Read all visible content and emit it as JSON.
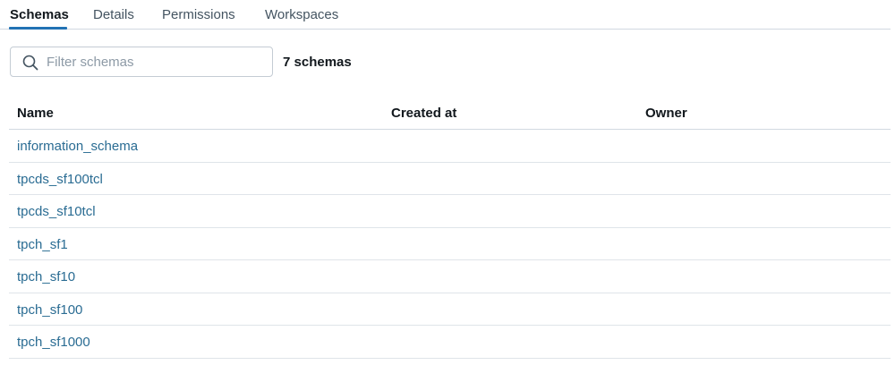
{
  "tabs": [
    {
      "label": "Schemas",
      "active": true
    },
    {
      "label": "Details",
      "active": false
    },
    {
      "label": "Permissions",
      "active": false
    },
    {
      "label": "Workspaces",
      "active": false
    }
  ],
  "search": {
    "placeholder": "Filter schemas",
    "value": ""
  },
  "count_label": "7 schemas",
  "table": {
    "columns": [
      "Name",
      "Created at",
      "Owner"
    ],
    "rows": [
      {
        "name": "information_schema",
        "created_at": "",
        "owner": ""
      },
      {
        "name": "tpcds_sf100tcl",
        "created_at": "",
        "owner": ""
      },
      {
        "name": "tpcds_sf10tcl",
        "created_at": "",
        "owner": ""
      },
      {
        "name": "tpch_sf1",
        "created_at": "",
        "owner": ""
      },
      {
        "name": "tpch_sf10",
        "created_at": "",
        "owner": ""
      },
      {
        "name": "tpch_sf100",
        "created_at": "",
        "owner": ""
      },
      {
        "name": "tpch_sf1000",
        "created_at": "",
        "owner": ""
      }
    ]
  },
  "colors": {
    "accent": "#2272b4",
    "link": "#2a6c93",
    "border": "#d1d9e1"
  },
  "icons": {
    "search": "search-icon"
  }
}
